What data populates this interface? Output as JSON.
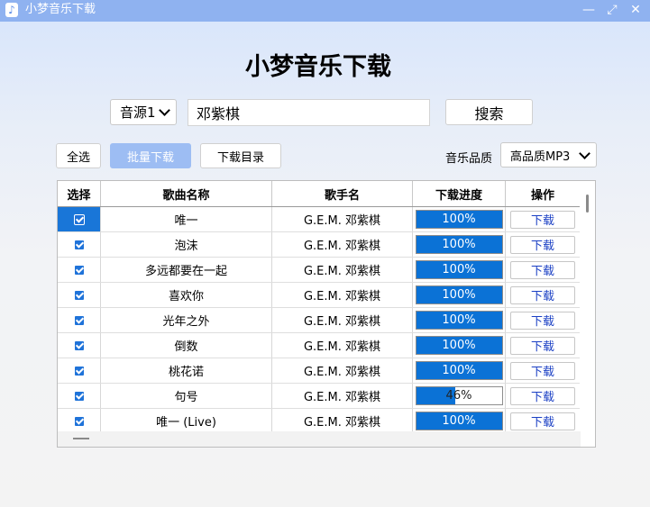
{
  "window": {
    "title": "小梦音乐下载",
    "icon": "music-note-icon",
    "controls": [
      "minimize-icon",
      "restore-icon",
      "close-icon"
    ]
  },
  "app_title": "小梦音乐下载",
  "search": {
    "source_selected": "音源1",
    "query": "邓紫棋",
    "search_label": "搜索"
  },
  "toolbar": {
    "select_all_label": "全选",
    "batch_download_label": "批量下载",
    "download_dir_label": "下载目录",
    "quality_label": "音乐品质",
    "quality_selected": "高品质MP3"
  },
  "table": {
    "headers": [
      "选择",
      "歌曲名称",
      "歌手名",
      "下载进度",
      "操作"
    ],
    "rows": [
      {
        "checked": true,
        "song": "唯一",
        "artist": "G.E.M. 邓紫棋",
        "progress": 100,
        "progress_text": "100%",
        "action": "下载"
      },
      {
        "checked": true,
        "song": "泡沫",
        "artist": "G.E.M. 邓紫棋",
        "progress": 100,
        "progress_text": "100%",
        "action": "下载"
      },
      {
        "checked": true,
        "song": "多远都要在一起",
        "artist": "G.E.M. 邓紫棋",
        "progress": 100,
        "progress_text": "100%",
        "action": "下载"
      },
      {
        "checked": true,
        "song": "喜欢你",
        "artist": "G.E.M. 邓紫棋",
        "progress": 100,
        "progress_text": "100%",
        "action": "下载"
      },
      {
        "checked": true,
        "song": "光年之外",
        "artist": "G.E.M. 邓紫棋",
        "progress": 100,
        "progress_text": "100%",
        "action": "下载"
      },
      {
        "checked": true,
        "song": "倒数",
        "artist": "G.E.M. 邓紫棋",
        "progress": 100,
        "progress_text": "100%",
        "action": "下载"
      },
      {
        "checked": true,
        "song": "桃花诺",
        "artist": "G.E.M. 邓紫棋",
        "progress": 100,
        "progress_text": "100%",
        "action": "下载"
      },
      {
        "checked": true,
        "song": "句号",
        "artist": "G.E.M. 邓紫棋",
        "progress": 46,
        "progress_text": "46%",
        "action": "下载"
      },
      {
        "checked": true,
        "song": "唯一 (Live)",
        "artist": "G.E.M. 邓紫棋",
        "progress": 100,
        "progress_text": "100%",
        "action": "下载"
      }
    ]
  },
  "colors": {
    "titlebar": "#8fb2f0",
    "accent": "#0b72d6",
    "primary_button": "#9dbdf3",
    "link": "#1a3fc4"
  }
}
